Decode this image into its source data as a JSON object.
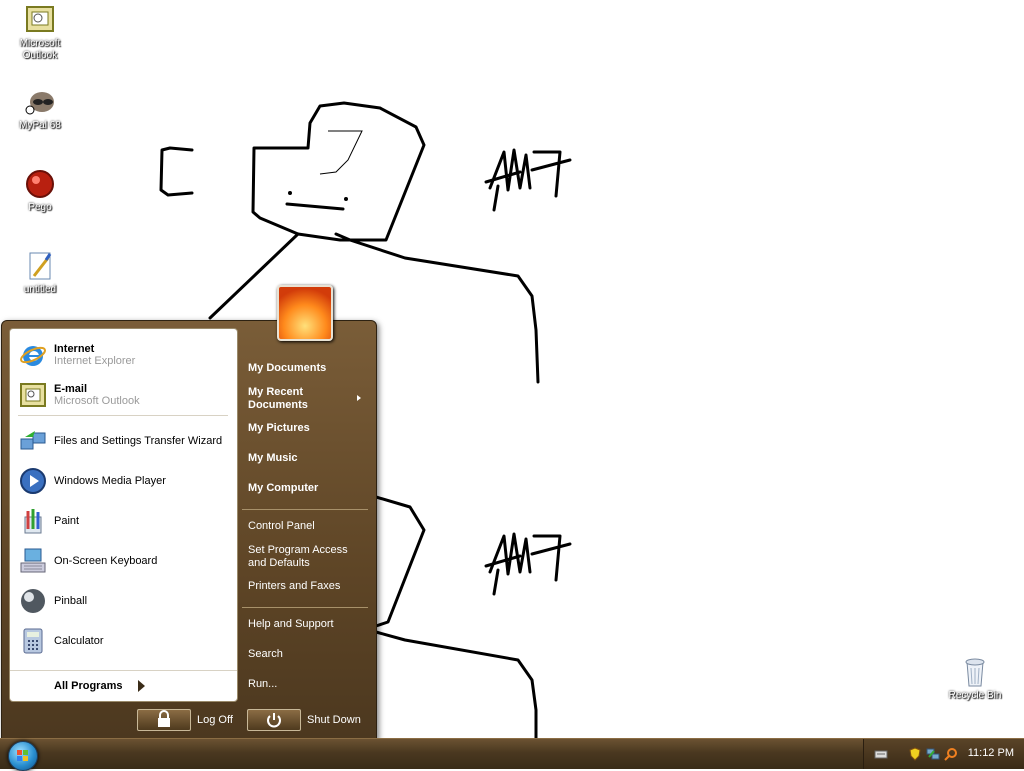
{
  "desktop": {
    "icons": [
      {
        "label": "Microsoft Outlook",
        "icon": "outlook-icon"
      },
      {
        "label": "MyPal 68",
        "icon": "raccoon-icon"
      },
      {
        "label": "Pego",
        "icon": "pego-icon"
      },
      {
        "label": "untitled",
        "icon": "paint-document-icon"
      },
      {
        "label": "Recycle Bin",
        "icon": "recycle-bin-icon"
      }
    ],
    "scribbles": [
      "C",
      "MM",
      "MM"
    ]
  },
  "start_menu": {
    "pinned": [
      {
        "title": "Internet",
        "subtitle": "Internet Explorer",
        "icon": "internet-explorer-icon"
      },
      {
        "title": "E-mail",
        "subtitle": "Microsoft Outlook",
        "icon": "outlook-icon"
      }
    ],
    "recent": [
      {
        "label": "Files and Settings Transfer Wizard",
        "icon": "transfer-wizard-icon"
      },
      {
        "label": "Windows Media Player",
        "icon": "media-player-icon"
      },
      {
        "label": "Paint",
        "icon": "paint-icon"
      },
      {
        "label": "On-Screen Keyboard",
        "icon": "keyboard-icon"
      },
      {
        "label": "Pinball",
        "icon": "pinball-icon"
      },
      {
        "label": "Calculator",
        "icon": "calculator-icon"
      }
    ],
    "all_programs": "All Programs",
    "right": {
      "my_documents": "My Documents",
      "my_recent_documents": "My Recent Documents",
      "my_pictures": "My Pictures",
      "my_music": "My Music",
      "my_computer": "My Computer",
      "control_panel": "Control Panel",
      "set_program_access": "Set Program Access and Defaults",
      "printers_faxes": "Printers and Faxes",
      "help_support": "Help and Support",
      "search": "Search",
      "run": "Run..."
    },
    "log_off": "Log Off",
    "shut_down": "Shut Down"
  },
  "taskbar": {
    "clock": "11:12 PM"
  },
  "colors": {
    "taskbar": "#4a3820",
    "menu_brown": "#5e4526",
    "drawing_stroke": "#000000"
  }
}
